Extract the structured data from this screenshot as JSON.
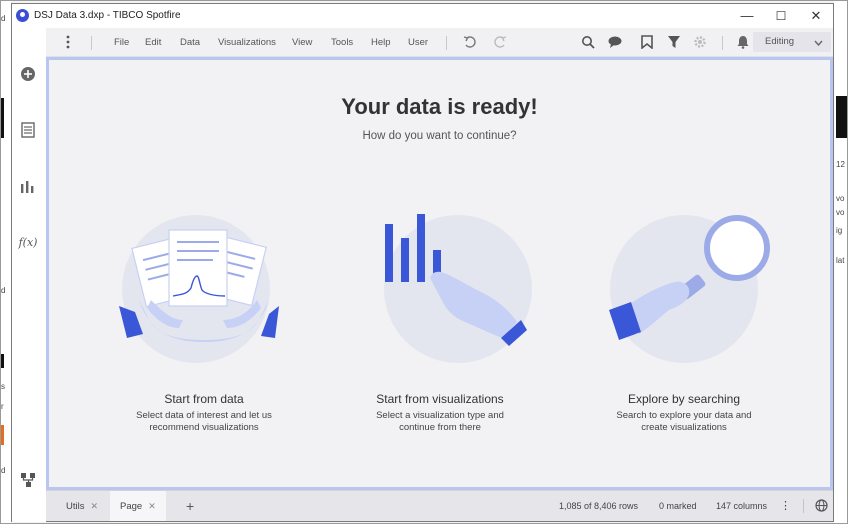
{
  "window": {
    "title": "DSJ Data 3.dxp - TIBCO Spotfire",
    "minimize": "—",
    "maximize": "☐",
    "close": "✕"
  },
  "background": {
    "left_fragments": [
      "d",
      "d",
      "s",
      "r",
      "s",
      "d"
    ],
    "right_fragments": [
      "12",
      "vo",
      "vo",
      "ig",
      "lat"
    ]
  },
  "rail": {
    "icons": [
      "add-icon",
      "data-table-icon",
      "bar-chart-icon",
      "function-icon",
      "flow-icon"
    ],
    "function_label": "f(x)"
  },
  "toolbar": {
    "menu": [
      "File",
      "Edit",
      "Data",
      "Visualizations",
      "View",
      "Tools",
      "Help",
      "User"
    ],
    "mode": "Editing",
    "icons": [
      "more-vert-icon",
      "undo-icon",
      "redo-icon",
      "search-icon",
      "comment-icon",
      "bookmark-icon",
      "filter-icon",
      "settings-icon",
      "notification-icon"
    ]
  },
  "main": {
    "title": "Your data is ready!",
    "subtitle": "How do you want to continue?",
    "cards": [
      {
        "title": "Start from data",
        "desc1": "Select data of interest and let us",
        "desc2": "recommend visualizations"
      },
      {
        "title": "Start from visualizations",
        "desc1": "Select a visualization type and",
        "desc2": "continue from there"
      },
      {
        "title": "Explore by searching",
        "desc1": "Search to explore your data and",
        "desc2": "create visualizations"
      }
    ]
  },
  "statusbar": {
    "tabs": [
      {
        "label": "Utils",
        "active": false
      },
      {
        "label": "Page",
        "active": true
      }
    ],
    "add_tab": "+",
    "rows": "1,085 of 8,406 rows",
    "marked": "0 marked",
    "columns": "147 columns",
    "more": "⋮"
  },
  "colors": {
    "accent": "#3a57d8",
    "accent_light": "#c7d0f5",
    "circle": "#e4e6ef",
    "highlight": "#b8c6f0"
  }
}
